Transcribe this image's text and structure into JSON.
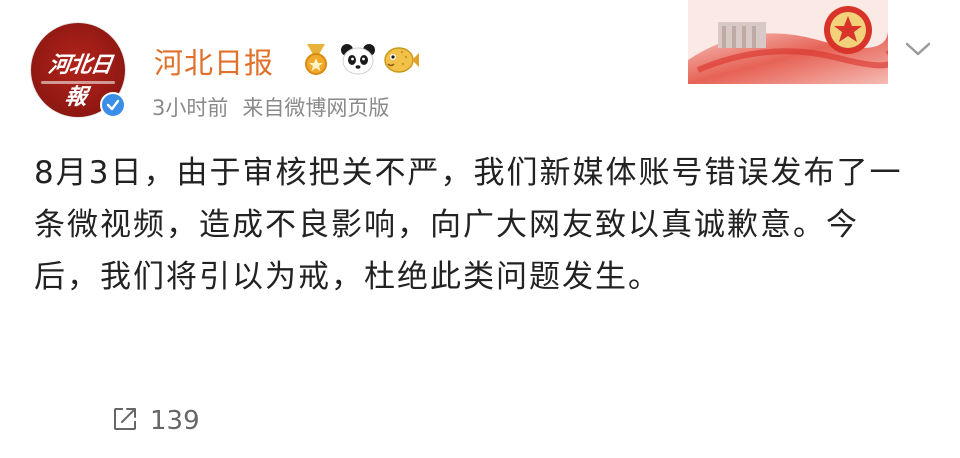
{
  "account": {
    "name": "河北日报",
    "avatar_logo": "河北日報",
    "time": "3小时前",
    "source": "来自微博网页版"
  },
  "badges": [
    "medal-badge-icon",
    "panda-badge-icon",
    "pufferfish-badge-icon"
  ],
  "post": {
    "text": "8月3日，由于审核把关不严，我们新媒体账号错误发布了一条微视频，造成不良影响，向广大网友致以真诚歉意。今后，我们将引以为戒，杜绝此类问题发生。"
  },
  "footer": {
    "share_count": "139"
  },
  "colors": {
    "name": "#e0702a",
    "meta": "#8a8a8a",
    "avatar_red": "#9c1c14",
    "verified_blue": "#3b8ee8"
  }
}
